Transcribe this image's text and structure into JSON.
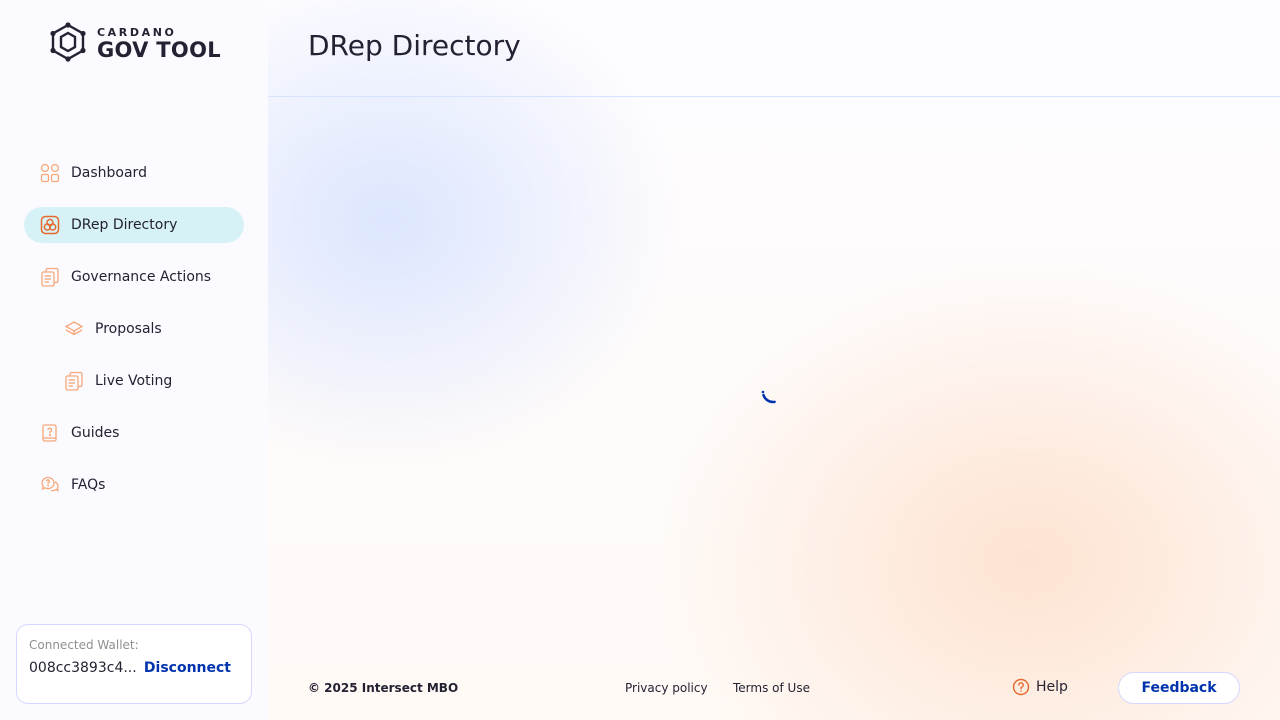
{
  "logo": {
    "small": "CARDANO",
    "big": "GOV TOOL"
  },
  "sidebar": {
    "items": [
      {
        "label": "Dashboard",
        "icon": "dashboard-icon"
      },
      {
        "label": "DRep Directory",
        "icon": "drep-directory-icon",
        "active": true
      },
      {
        "label": "Governance Actions",
        "icon": "governance-actions-icon"
      },
      {
        "label": "Proposals",
        "icon": "proposals-icon"
      },
      {
        "label": "Live Voting",
        "icon": "live-voting-icon"
      },
      {
        "label": "Guides",
        "icon": "guides-icon"
      },
      {
        "label": "FAQs",
        "icon": "faqs-icon"
      }
    ]
  },
  "wallet": {
    "label": "Connected Wallet:",
    "address": "008cc3893c4...",
    "disconnect_label": "Disconnect"
  },
  "header": {
    "title": "DRep Directory"
  },
  "footer": {
    "copyright": "© 2025 Intersect MBO",
    "privacy": "Privacy policy",
    "terms": "Terms of Use",
    "help": "Help",
    "feedback": "Feedback"
  },
  "colors": {
    "accent": "#0033ad",
    "icon_orange": "#f7a77a",
    "active_bg": "#d6f2f6",
    "text": "#242232"
  }
}
